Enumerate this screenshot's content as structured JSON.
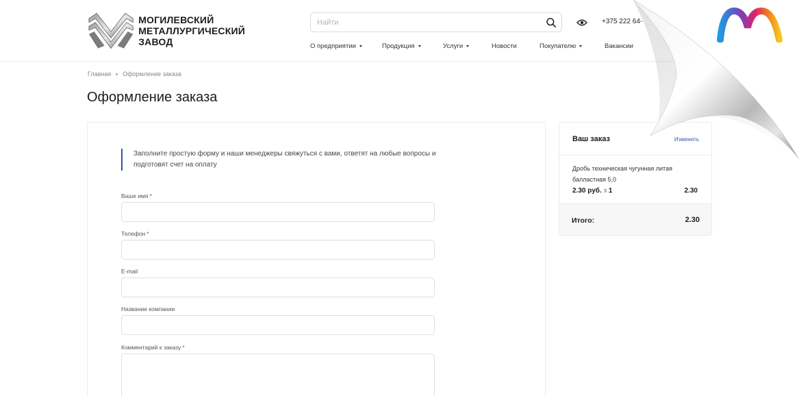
{
  "header": {
    "logo_lines": [
      "МОГИЛЕВСКИЙ",
      "МЕТАЛЛУРГИЧЕСКИЙ",
      "ЗАВОД"
    ],
    "search_placeholder": "Найти",
    "phone": "+375 222 64-",
    "nav": [
      {
        "label": "О предприятии",
        "dropdown": true
      },
      {
        "label": "Продукция",
        "dropdown": true
      },
      {
        "label": "Услуги",
        "dropdown": true
      },
      {
        "label": "Новости",
        "dropdown": false
      },
      {
        "label": "Покупателю",
        "dropdown": true
      },
      {
        "label": "Вакансии",
        "dropdown": false
      }
    ]
  },
  "breadcrumb": {
    "home": "Главная",
    "current": "Оформление заказа"
  },
  "page_title": "Оформление заказа",
  "form": {
    "intro": "Заполните простую форму и наши менеджеры свяжуться с вами, ответят на любые вопросы и подготовят счет на оплату",
    "fields": {
      "name": {
        "label": "Ваше имя",
        "required": "*",
        "value": ""
      },
      "phone": {
        "label": "Телефон",
        "required": "*",
        "value": ""
      },
      "email": {
        "label": "E-mail",
        "value": ""
      },
      "company": {
        "label": "Название компании",
        "value": ""
      },
      "comment": {
        "label": "Комментарий к заказу",
        "required": "*",
        "value": ""
      }
    }
  },
  "order": {
    "title": "Ваш заказ",
    "edit_label": "Изменить",
    "item": {
      "name": "Дробь техническая чугунная литая балластная 5,0",
      "price": "2.30 руб.",
      "times": "x",
      "qty": "1",
      "sum": "2.30"
    },
    "total_label": "Итого:",
    "total_value": "2.30"
  },
  "icons": {
    "search": "search-icon",
    "eye": "eye-icon",
    "brand": "brand-m-logo"
  },
  "colors": {
    "accent": "#2b5aa8",
    "required": "#e02b2b",
    "total_bg": "#f7f7f7"
  }
}
